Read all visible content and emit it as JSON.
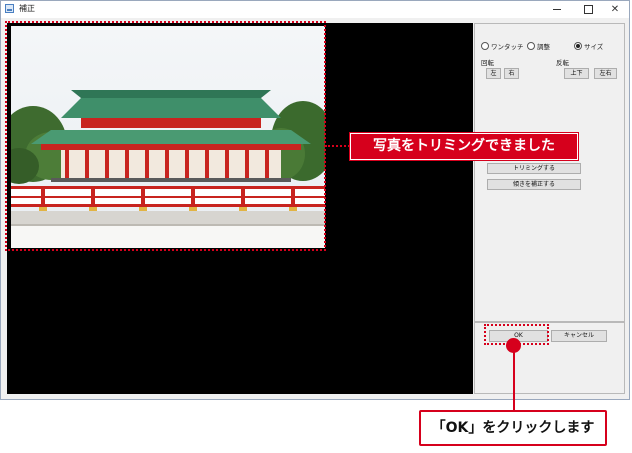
{
  "window": {
    "title": "補正",
    "minimize_label": "",
    "maximize_label": "",
    "close_label": "✕"
  },
  "options": {
    "mode_one_touch": "ワンタッチ",
    "mode_adjust": "調整",
    "mode_size": "サイズ",
    "selected": "サイズ"
  },
  "rotate": {
    "label": "回転",
    "left": "左",
    "right": "右"
  },
  "flip": {
    "label": "反転",
    "vertical": "上下",
    "horizontal": "左右"
  },
  "actions": {
    "trim": "トリミングする",
    "tilt": "傾きを補正する"
  },
  "dialog_buttons": {
    "ok": "OK",
    "cancel": "キャンセル"
  },
  "annotations": {
    "trimmed_message": "写真をトリミングできました",
    "click_ok_message": "「OK」をクリックします"
  },
  "colors": {
    "accent": "#d6001c",
    "roof": "#3f8f6a",
    "pillar": "#c8241f"
  },
  "icons": {
    "app": "window-app-icon",
    "minimize": "minimize-icon",
    "maximize": "maximize-icon",
    "close": "close-icon"
  }
}
